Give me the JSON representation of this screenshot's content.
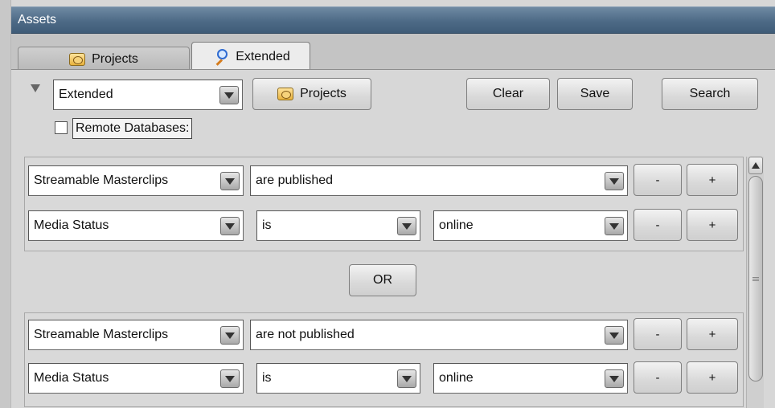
{
  "window": {
    "title": "Assets"
  },
  "tabs": [
    {
      "label": "Projects",
      "icon": "projects-icon"
    },
    {
      "label": "Extended",
      "icon": "search-icon"
    }
  ],
  "toolbar": {
    "mode_value": "Extended",
    "projects_label": "Projects",
    "clear_label": "Clear",
    "save_label": "Save",
    "search_label": "Search",
    "remote_label": "Remote Databases:"
  },
  "groups": [
    {
      "rows": [
        {
          "field": "Streamable Masterclips",
          "operator": "are published",
          "minus": "-",
          "plus": "+"
        },
        {
          "field": "Media Status",
          "operator": "is",
          "value": "online",
          "minus": "-",
          "plus": "+"
        }
      ]
    },
    {
      "rows": [
        {
          "field": "Streamable Masterclips",
          "operator": "are not published",
          "minus": "-",
          "plus": "+"
        },
        {
          "field": "Media Status",
          "operator": "is",
          "value": "online",
          "minus": "-",
          "plus": "+"
        }
      ]
    }
  ],
  "or_label": "OR"
}
